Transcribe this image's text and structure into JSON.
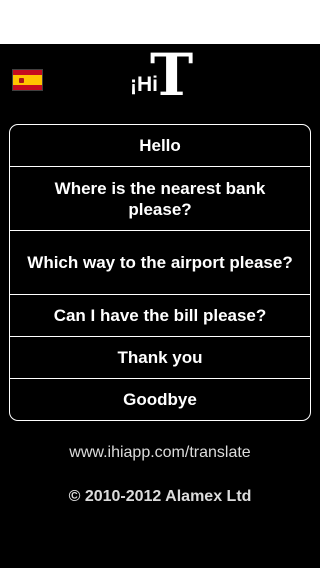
{
  "header": {
    "flag_icon": "spain-flag-icon",
    "logo": {
      "hi_text": "¡Hi",
      "t_text": "T"
    }
  },
  "phrases": [
    "Hello",
    "Where is the nearest bank please?",
    "Which way to the airport please?",
    "Can I have the bill please?",
    "Thank you",
    "Goodbye"
  ],
  "footer": {
    "website": "www.ihiapp.com/translate",
    "copyright": "© 2010-2012 Alamex Ltd"
  },
  "colors": {
    "background": "#000000",
    "text": "#ffffff",
    "footer_text": "#dcdcdc",
    "flag_red": "#c60b1e",
    "flag_yellow": "#ffc400"
  }
}
